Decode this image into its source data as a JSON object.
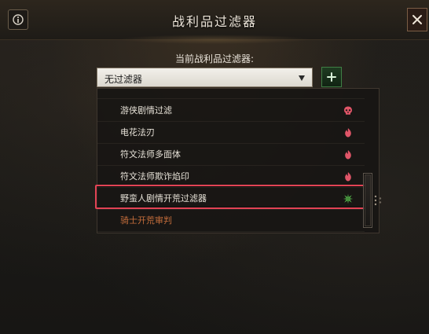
{
  "header": {
    "title": "战利品过滤器",
    "info_icon": "info-icon",
    "close_icon": "close-icon"
  },
  "filter": {
    "current_label": "当前战利品过滤器:",
    "selected_value": "无过滤器",
    "dropdown_icon": "chevron-down-icon",
    "add_icon": "plus-icon"
  },
  "dropdown_list": {
    "items": [
      {
        "label": "游侠剧情过滤",
        "icon": "skull-icon",
        "icon_color": "#e05568"
      },
      {
        "label": "电花法刃",
        "icon": "flame-icon",
        "icon_color": "#e05568"
      },
      {
        "label": "符文法师多面体",
        "icon": "flame-icon",
        "icon_color": "#e05568"
      },
      {
        "label": "符文法师欺诈焰印",
        "icon": "flame-icon",
        "icon_color": "#e05568"
      },
      {
        "label": "野蛮人剧情开荒过滤器",
        "icon": "burst-icon",
        "icon_color": "#58c24e"
      },
      {
        "label": "骑士开荒审判",
        "icon": "",
        "icon_color": ""
      }
    ]
  },
  "colors": {
    "highlight": "#e24355",
    "accent_green": "#3f7f45",
    "accent_orange": "#c46d3b"
  }
}
